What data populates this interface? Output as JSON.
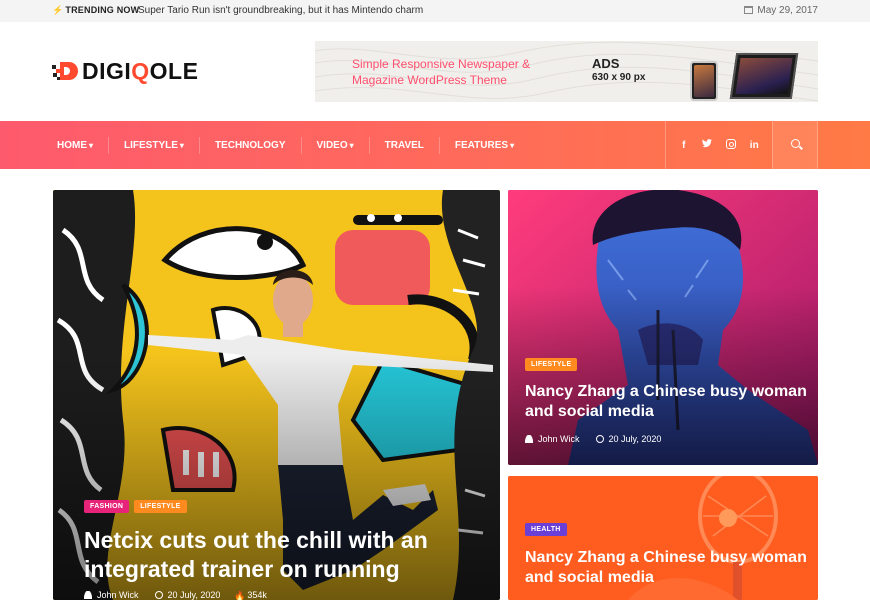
{
  "topbar": {
    "trending_label": "TRENDING NOW",
    "trending_text": "Super Tario Run isn't groundbreaking, but it has Mintendo charm",
    "date": "May 29, 2017"
  },
  "header": {
    "logo_prefix": "DIGI",
    "logo_q": "Q",
    "logo_suffix": "OLE",
    "ad": {
      "title": "Simple Responsive Newspaper & Magazine WordPress Theme",
      "label": "ADS",
      "size": "630 x 90 px"
    }
  },
  "nav": {
    "items": [
      {
        "label": "HOME",
        "has_dropdown": true
      },
      {
        "label": "LIFESTYLE",
        "has_dropdown": true
      },
      {
        "label": "TECHNOLOGY",
        "has_dropdown": false
      },
      {
        "label": "VIDEO",
        "has_dropdown": true
      },
      {
        "label": "TRAVEL",
        "has_dropdown": false
      },
      {
        "label": "FEATURES",
        "has_dropdown": true
      }
    ],
    "social": [
      {
        "icon": "facebook-icon",
        "glyph": "f"
      },
      {
        "icon": "twitter-icon",
        "glyph": "🐦"
      },
      {
        "icon": "instagram-icon",
        "glyph": ""
      },
      {
        "icon": "linkedin-icon",
        "glyph": "in"
      }
    ],
    "search_icon": "search-icon"
  },
  "posts": {
    "main": {
      "tags": [
        {
          "label": "FASHION",
          "color": "#e8247a"
        },
        {
          "label": "LIFESTYLE",
          "color": "#ff8a1f"
        }
      ],
      "title": "Netcix cuts out the chill with an integrated trainer on running",
      "author": "John Wick",
      "date": "20 July, 2020",
      "views": "354k"
    },
    "second": {
      "tag": {
        "label": "LIFESTYLE",
        "color": "#ff8a1f"
      },
      "title": "Nancy Zhang a Chinese busy woman and social media",
      "author": "John Wick",
      "date": "20 July, 2020"
    },
    "third": {
      "tag": {
        "label": "HEALTH",
        "color": "#6a3fd6"
      },
      "title": "Nancy Zhang a Chinese busy woman and social media"
    }
  },
  "colors": {
    "accent": "#ff4a2f",
    "nav_gradient_start": "#fe5a6d",
    "nav_gradient_end": "#ff7a45"
  }
}
